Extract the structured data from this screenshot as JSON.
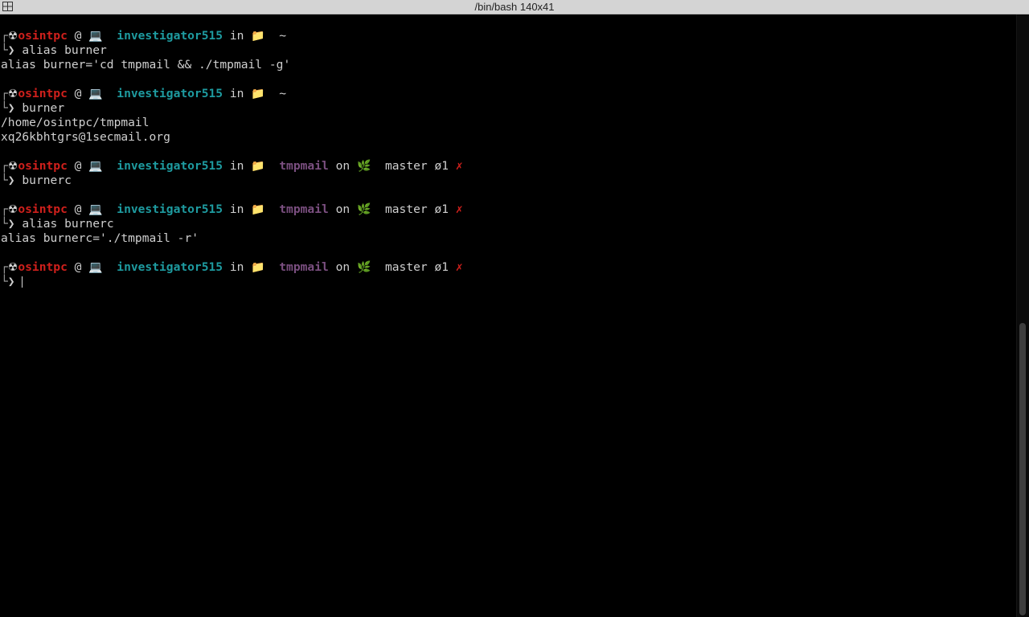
{
  "window": {
    "title": "/bin/bash 140x41"
  },
  "prompt": {
    "radiation": "☢",
    "user": "osintpc",
    "at": "@",
    "laptop": "💻",
    "host": "investigator515",
    "in": "in",
    "folder": "📁",
    "on": "on",
    "leaf": "🌿",
    "branch": "master",
    "status": "ø1",
    "x": "✗",
    "bracket_top": "┌",
    "bracket_bottom": "└",
    "arrow": "❯"
  },
  "blocks": [
    {
      "dir": "~",
      "git": false,
      "command": "alias burner",
      "output": [
        "alias burner='cd tmpmail && ./tmpmail -g'"
      ]
    },
    {
      "dir": "~",
      "git": false,
      "command": "burner",
      "output": [
        "/home/osintpc/tmpmail",
        "xq26kbhtgrs@1secmail.org"
      ]
    },
    {
      "dir": "tmpmail",
      "git": true,
      "command": "burnerc",
      "output": []
    },
    {
      "dir": "tmpmail",
      "git": true,
      "command": "alias burnerc",
      "output": [
        "alias burnerc='./tmpmail -r'"
      ]
    },
    {
      "dir": "tmpmail",
      "git": true,
      "command": "",
      "output": []
    }
  ],
  "scroll": {
    "position_fraction": 0.51,
    "visible_fraction": 0.49
  }
}
